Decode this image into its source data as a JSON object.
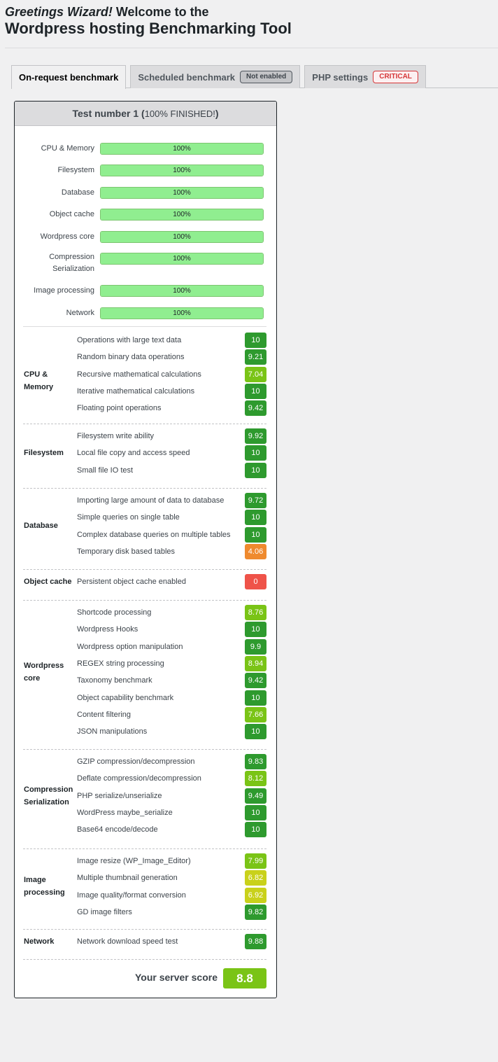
{
  "header": {
    "greeting": "Greetings Wizard!",
    "welcome": " Welcome to the",
    "title": "Wordpress hosting Benchmarking Tool"
  },
  "tabs": [
    {
      "label": "On-request benchmark",
      "active": true
    },
    {
      "label": "Scheduled benchmark",
      "badge": "Not enabled"
    },
    {
      "label": "PHP settings",
      "badge": "CRITICAL"
    }
  ],
  "test": {
    "title_prefix": "Test number 1 (",
    "status": "100% FINISHED!",
    "title_suffix": ")"
  },
  "progress": [
    {
      "label": "CPU & Memory",
      "value": 100,
      "text": "100%"
    },
    {
      "label": "Filesystem",
      "value": 100,
      "text": "100%"
    },
    {
      "label": "Database",
      "value": 100,
      "text": "100%"
    },
    {
      "label": "Object cache",
      "value": 100,
      "text": "100%"
    },
    {
      "label": "Wordpress core",
      "value": 100,
      "text": "100%"
    },
    {
      "label": "Compression Serialization",
      "value": 100,
      "text": "100%"
    },
    {
      "label": "Image processing",
      "value": 100,
      "text": "100%"
    },
    {
      "label": "Network",
      "value": 100,
      "text": "100%"
    }
  ],
  "sections": [
    {
      "category": "CPU & Memory",
      "tests": [
        {
          "name": "Operations with large text data",
          "score": "10"
        },
        {
          "name": "Random binary data operations",
          "score": "9.21"
        },
        {
          "name": "Recursive mathematical calculations",
          "score": "7.04"
        },
        {
          "name": "Iterative mathematical calculations",
          "score": "10"
        },
        {
          "name": "Floating point operations",
          "score": "9.42"
        }
      ]
    },
    {
      "category": "Filesystem",
      "tests": [
        {
          "name": "Filesystem write ability",
          "score": "9.92"
        },
        {
          "name": "Local file copy and access speed",
          "score": "10"
        },
        {
          "name": "Small file IO test",
          "score": "10"
        }
      ]
    },
    {
      "category": "Database",
      "tests": [
        {
          "name": "Importing large amount of data to database",
          "score": "9.72"
        },
        {
          "name": "Simple queries on single table",
          "score": "10"
        },
        {
          "name": "Complex database queries on multiple tables",
          "score": "10"
        },
        {
          "name": "Temporary disk based tables",
          "score": "4.06"
        }
      ]
    },
    {
      "category": "Object cache",
      "tests": [
        {
          "name": "Persistent object cache enabled",
          "score": "0"
        }
      ]
    },
    {
      "category": "Wordpress core",
      "tests": [
        {
          "name": "Shortcode processing",
          "score": "8.76"
        },
        {
          "name": "Wordpress Hooks",
          "score": "10"
        },
        {
          "name": "Wordpress option manipulation",
          "score": "9.9"
        },
        {
          "name": "REGEX string processing",
          "score": "8.94"
        },
        {
          "name": "Taxonomy benchmark",
          "score": "9.42"
        },
        {
          "name": "Object capability benchmark",
          "score": "10"
        },
        {
          "name": "Content filtering",
          "score": "7.66"
        },
        {
          "name": "JSON manipulations",
          "score": "10"
        }
      ]
    },
    {
      "category": "Compression Serialization",
      "tests": [
        {
          "name": "GZIP compression/decompression",
          "score": "9.83"
        },
        {
          "name": "Deflate compression/decompression",
          "score": "8.12"
        },
        {
          "name": "PHP serialize/unserialize",
          "score": "9.49"
        },
        {
          "name": "WordPress maybe_serialize",
          "score": "10"
        },
        {
          "name": "Base64 encode/decode",
          "score": "10"
        }
      ]
    },
    {
      "category": "Image processing",
      "tests": [
        {
          "name": "Image resize (WP_Image_Editor)",
          "score": "7.99"
        },
        {
          "name": "Multiple thumbnail generation",
          "score": "6.82"
        },
        {
          "name": "Image quality/format conversion",
          "score": "6.92"
        },
        {
          "name": "GD image filters",
          "score": "9.82"
        }
      ]
    },
    {
      "category": "Network",
      "tests": [
        {
          "name": "Network download speed test",
          "score": "9.88"
        }
      ]
    }
  ],
  "final": {
    "label": "Your server score",
    "score": "8.8"
  },
  "colors": {
    "score_high": "#2e9a2e",
    "score_good": "#7ac416",
    "score_mid": "#c9d11b",
    "score_low": "#ef8a2e",
    "score_zero": "#ef5349",
    "progress_fill": "#90ee90",
    "critical": "#d63638"
  }
}
